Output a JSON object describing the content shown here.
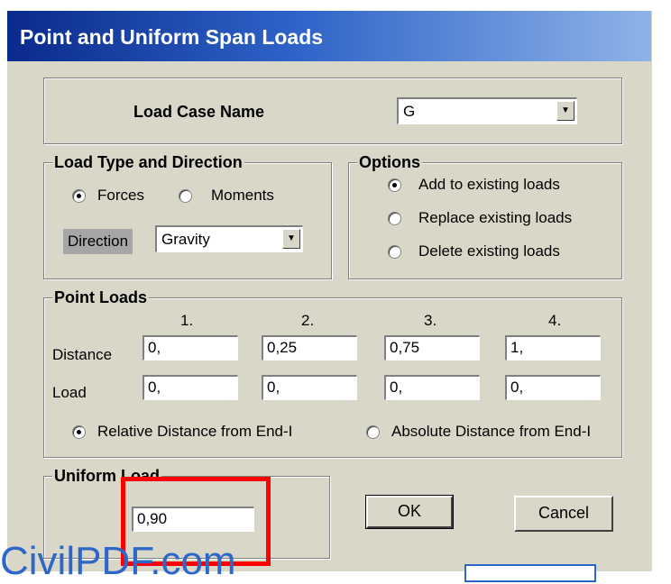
{
  "dialog": {
    "title": "Point and Uniform Span Loads"
  },
  "load_case": {
    "label": "Load Case Name",
    "value": "G"
  },
  "load_type": {
    "legend": "Load Type and Direction",
    "forces_label": "Forces",
    "moments_label": "Moments",
    "selected": "Forces",
    "direction_label": "Direction",
    "direction_value": "Gravity"
  },
  "options": {
    "legend": "Options",
    "items": [
      "Add to existing loads",
      "Replace existing loads",
      "Delete existing loads"
    ],
    "selected": "Add to existing loads"
  },
  "point_loads": {
    "legend": "Point Loads",
    "columns": [
      "1.",
      "2.",
      "3.",
      "4."
    ],
    "distance_label": "Distance",
    "distance_values": [
      "0,",
      "0,25",
      "0,75",
      "1,"
    ],
    "load_label": "Load",
    "load_values": [
      "0,",
      "0,",
      "0,",
      "0,"
    ],
    "relative_label": "Relative Distance from End-I",
    "absolute_label": "Absolute Distance from End-I",
    "selected": "Relative Distance from End-I"
  },
  "uniform_load": {
    "legend": "Uniform Load",
    "value": "0,90"
  },
  "buttons": {
    "ok": "OK",
    "cancel": "Cancel"
  },
  "watermark": "CivilPDF.com"
}
